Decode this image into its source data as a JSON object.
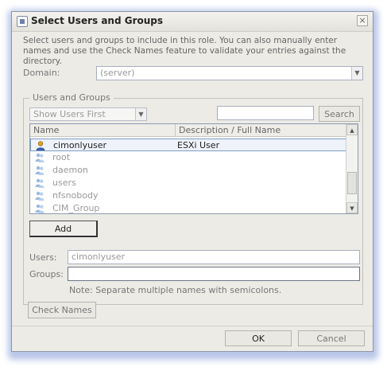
{
  "window": {
    "title": "Select Users and Groups",
    "close_glyph": "×"
  },
  "description": "Select users and groups to include in this role. You can also manually enter names and use the Check Names feature to validate your entries against the directory.",
  "domain": {
    "label": "Domain:",
    "value": "(server)"
  },
  "users_groups": {
    "group_label": "Users and Groups",
    "filter_value": "Show Users First",
    "search_value": "",
    "search_button": "Search",
    "columns": [
      "Name",
      "Description / Full Name"
    ],
    "rows": [
      {
        "name": "cimonlyuser",
        "description": "ESXi User",
        "type": "user",
        "selected": true
      },
      {
        "name": "root",
        "description": "",
        "type": "group",
        "selected": false
      },
      {
        "name": "daemon",
        "description": "",
        "type": "group",
        "selected": false
      },
      {
        "name": "users",
        "description": "",
        "type": "group",
        "selected": false
      },
      {
        "name": "nfsnobody",
        "description": "",
        "type": "group",
        "selected": false
      },
      {
        "name": "CIM_Group",
        "description": "",
        "type": "group",
        "selected": false
      }
    ],
    "add_button": "Add"
  },
  "users_field": {
    "label": "Users:",
    "value": "cimonlyuser"
  },
  "groups_field": {
    "label": "Groups:",
    "value": ""
  },
  "note": "Note: Separate multiple names with semicolons.",
  "check_names_button": "Check Names",
  "ok_button": "OK",
  "cancel_button": "Cancel",
  "colors": {
    "user_icon": "#e0a020",
    "group_icon": "#9ab8e0"
  }
}
